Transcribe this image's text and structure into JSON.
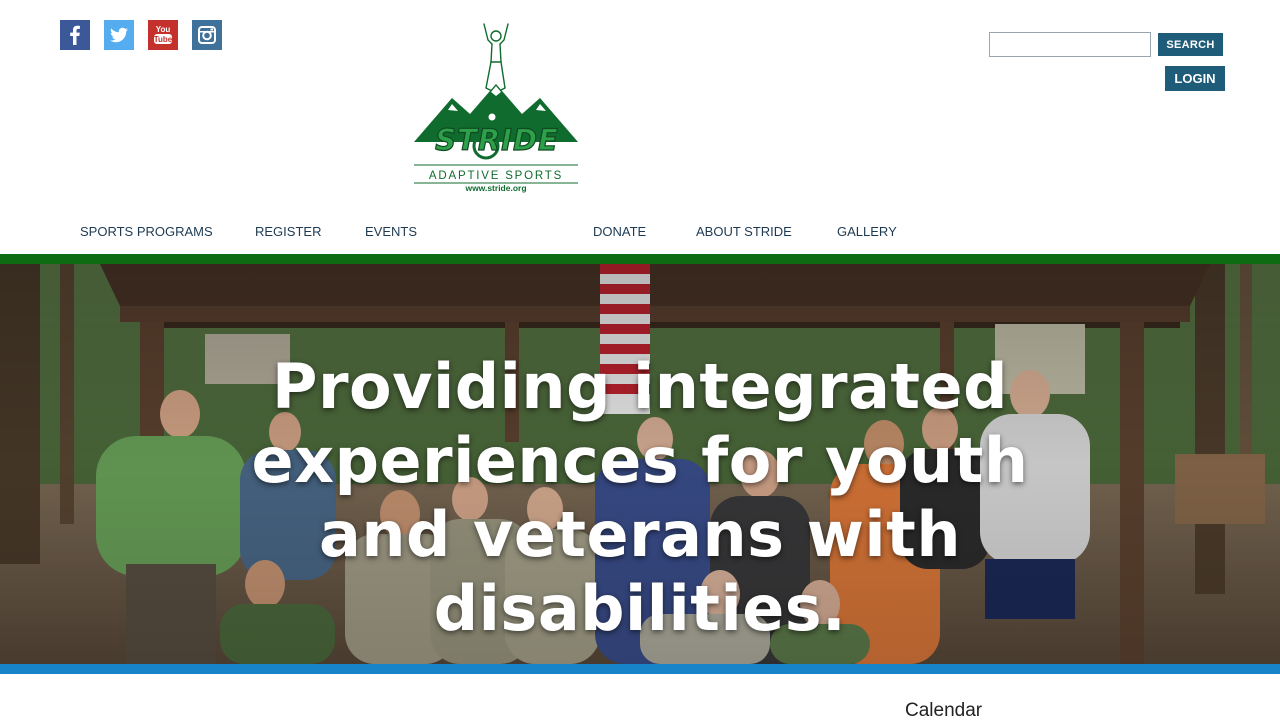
{
  "social": {
    "items": [
      {
        "name": "facebook",
        "icon": "facebook-icon",
        "color": "#3b5998"
      },
      {
        "name": "twitter",
        "icon": "twitter-icon",
        "color": "#55acee"
      },
      {
        "name": "youtube",
        "icon": "youtube-icon",
        "color": "#c4302b"
      },
      {
        "name": "instagram",
        "icon": "instagram-icon",
        "color": "#3f729b"
      }
    ]
  },
  "logo": {
    "brand": "STRIDE",
    "tagline": "ADAPTIVE SPORTS",
    "url": "www.stride.org",
    "color": "#0f6b2e"
  },
  "search": {
    "value": "",
    "placeholder": "",
    "button_label": "SEARCH"
  },
  "login": {
    "label": "LOGIN"
  },
  "nav": {
    "items": [
      {
        "label": "SPORTS PROGRAMS"
      },
      {
        "label": "REGISTER"
      },
      {
        "label": "EVENTS"
      },
      {
        "label": "DONATE"
      },
      {
        "label": "ABOUT STRIDE"
      },
      {
        "label": "GALLERY"
      }
    ]
  },
  "hero": {
    "headline": "Providing integrated experiences for youth and veterans with disabilities."
  },
  "sidebar": {
    "calendar_heading": "Calendar"
  },
  "colors": {
    "green_bar": "#0f6b12",
    "blue_bar": "#1784c9",
    "button": "#1f5c7a",
    "nav_text": "#1e3a52"
  }
}
